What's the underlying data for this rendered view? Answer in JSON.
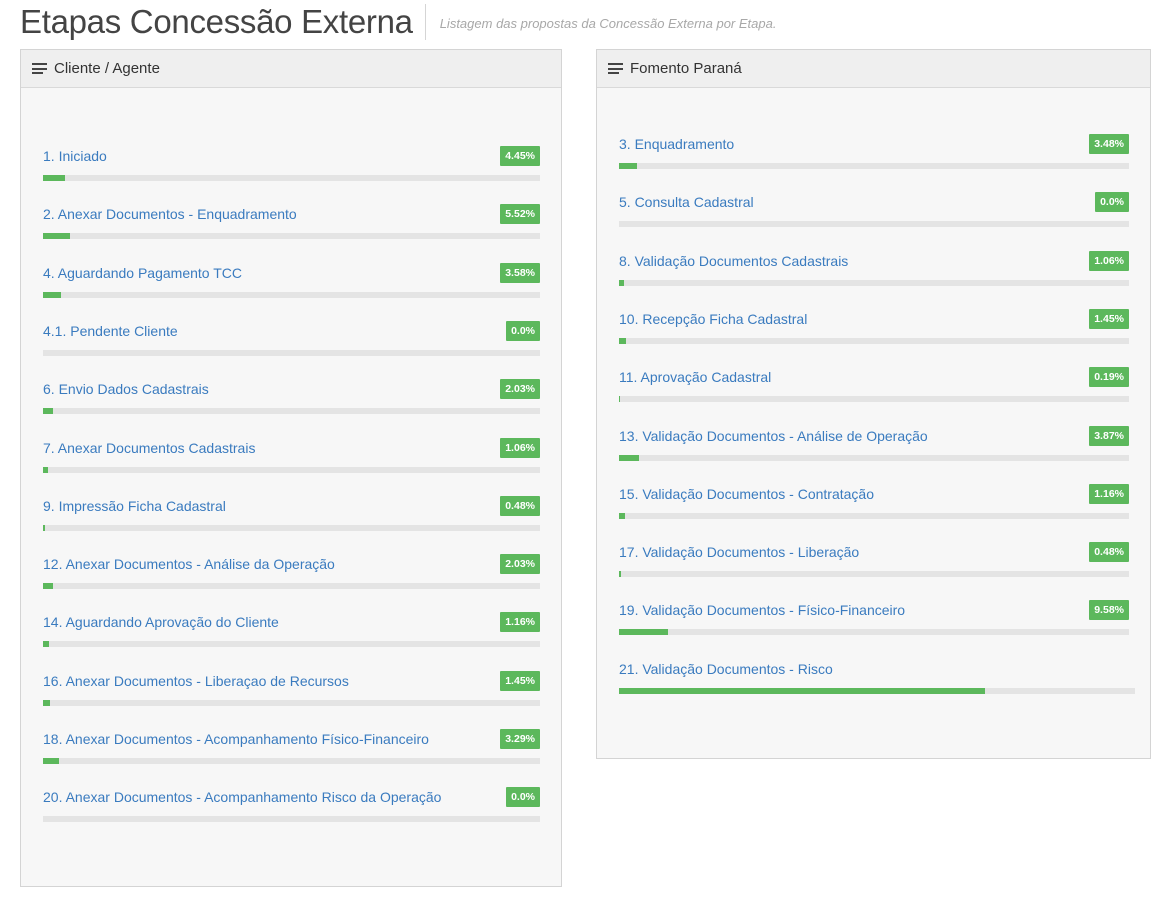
{
  "header": {
    "title": "Etapas Concessão Externa",
    "subtitle": "Listagem das propostas da Concessão Externa por Etapa."
  },
  "colors": {
    "accent": "#5cb85c",
    "link": "#3a7bbf"
  },
  "panels": {
    "cliente": {
      "title": "Cliente / Agente",
      "icon": "list-icon",
      "stages": [
        {
          "label": "1. Iniciado",
          "badge": "4.45%",
          "progress": 4.45
        },
        {
          "label": "2. Anexar Documentos - Enquadramento",
          "badge": "5.52%",
          "progress": 5.52
        },
        {
          "label": "4. Aguardando Pagamento TCC",
          "badge": "3.58%",
          "progress": 3.58
        },
        {
          "label": "4.1. Pendente Cliente",
          "badge": "0.0%",
          "progress": 0.0
        },
        {
          "label": "6. Envio Dados Cadastrais",
          "badge": "2.03%",
          "progress": 2.03
        },
        {
          "label": "7. Anexar Documentos Cadastrais",
          "badge": "1.06%",
          "progress": 1.06
        },
        {
          "label": "9. Impressão Ficha Cadastral",
          "badge": "0.48%",
          "progress": 0.48
        },
        {
          "label": "12. Anexar Documentos - Análise da Operação",
          "badge": "2.03%",
          "progress": 2.03
        },
        {
          "label": "14. Aguardando Aprovação do Cliente",
          "badge": "1.16%",
          "progress": 1.16
        },
        {
          "label": "16. Anexar Documentos - Liberaçao de Recursos",
          "badge": "1.45%",
          "progress": 1.45
        },
        {
          "label": "18. Anexar Documentos - Acompanhamento Físico-Financeiro",
          "badge": "3.29%",
          "progress": 3.29
        },
        {
          "label": "20. Anexar Documentos - Acompanhamento Risco da Operação",
          "badge": "0.0%",
          "progress": 0.0
        }
      ]
    },
    "fomento": {
      "title": "Fomento Paraná",
      "icon": "list-icon",
      "stages": [
        {
          "label": "3. Enquadramento",
          "badge": "3.48%",
          "progress": 3.48
        },
        {
          "label": "5. Consulta Cadastral",
          "badge": "0.0%",
          "progress": 0.0
        },
        {
          "label": "8. Validação Documentos Cadastrais",
          "badge": "1.06%",
          "progress": 1.06
        },
        {
          "label": "10. Recepção Ficha Cadastral",
          "badge": "1.45%",
          "progress": 1.45
        },
        {
          "label": "11. Aprovação Cadastral",
          "badge": "0.19%",
          "progress": 0.19
        },
        {
          "label": "13. Validação Documentos - Análise de Operação",
          "badge": "3.87%",
          "progress": 3.87
        },
        {
          "label": "15. Validação Documentos - Contratação",
          "badge": "1.16%",
          "progress": 1.16
        },
        {
          "label": "17. Validação Documentos - Liberação",
          "badge": "0.48%",
          "progress": 0.48
        },
        {
          "label": "19. Validação Documentos - Físico-Financeiro",
          "badge": "9.58%",
          "progress": 9.58
        },
        {
          "label": "21. Validação Documentos - Risco",
          "badge": "",
          "progress": 71.0
        }
      ]
    }
  }
}
